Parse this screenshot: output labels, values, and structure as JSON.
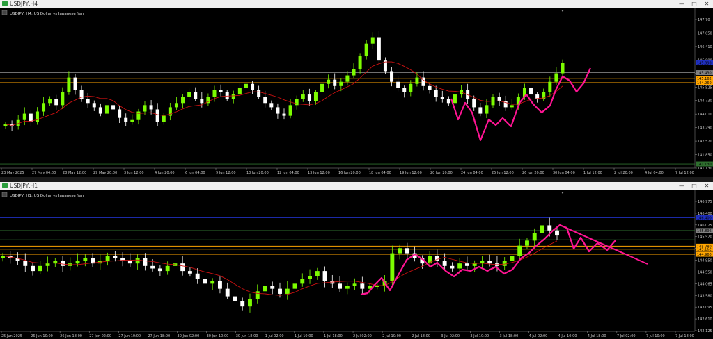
{
  "windows": [
    {
      "title": "USDJPY,H4",
      "header": "USDJPY, H4:  US Dollar vs Japanese Yen",
      "controls": [
        "—",
        "□",
        "✕"
      ]
    },
    {
      "title": "USDJPY,H1",
      "header": "USDJPY, H1:  US Dollar vs Japanese Yen",
      "controls": [
        "—",
        "□",
        "✕"
      ]
    }
  ],
  "colors": {
    "bull": "#7cfc00",
    "bear": "#ffffff",
    "ma": "#cc1111",
    "drawing": "#ff1493",
    "hline_blue": "#1f2fbf",
    "hline_orange": "#ffa500",
    "hline_gray": "#808080",
    "hline_green": "#2e6e2e"
  },
  "chart_data": [
    {
      "type": "candlestick",
      "title": "USDJPY, H4: US Dollar vs Japanese Yen",
      "ylim": [
        141.0,
        148.0
      ],
      "yticks": [
        "147.70",
        "147.050",
        "146.410",
        "145.890",
        "145.730",
        "145.525",
        "144.730",
        "144.010",
        "143.290",
        "142.570",
        "141.850",
        "141.130"
      ],
      "xticks": [
        "23 May 2025",
        "27 May 04:00",
        "28 May 12:00",
        "29 May 20:00",
        "3 Jun 12:00",
        "4 Jun 20:00",
        "6 Jun 04:00",
        "9 Jun 12:00",
        "10 Jun 20:00",
        "12 Jun 04:00",
        "13 Jun 12:00",
        "16 Jun 20:00",
        "18 Jun 04:00",
        "19 Jun 12:00",
        "20 Jun 20:00",
        "24 Jun 04:00",
        "25 Jun 12:00",
        "26 Jun 20:00",
        "30 Jun 04:00",
        "1 Jul 12:00",
        "2 Jul 20:00",
        "4 Jul 04:00",
        "7 Jul 12:00"
      ],
      "price_labels": [
        {
          "text": "145.890",
          "bg": "#1f2fbf"
        },
        {
          "text": "145.430",
          "bg": "#808080"
        },
        {
          "text": "145.162",
          "bg": "#ffa500"
        },
        {
          "text": "144.960",
          "bg": "#ffa500"
        },
        {
          "text": "141.130",
          "bg": "#2e6e2e"
        }
      ],
      "hlines": [
        {
          "y": 145.89,
          "color": "blue"
        },
        {
          "y": 145.43,
          "color": "gray"
        },
        {
          "y": 145.16,
          "color": "orange"
        },
        {
          "y": 144.96,
          "color": "orange"
        },
        {
          "y": 141.13,
          "color": "green"
        }
      ],
      "close": [
        143.0,
        142.9,
        143.2,
        143.5,
        143.1,
        143.6,
        144.0,
        144.2,
        143.9,
        144.5,
        145.2,
        144.6,
        144.2,
        144.0,
        143.8,
        143.5,
        143.9,
        143.7,
        143.3,
        143.1,
        143.2,
        143.6,
        143.9,
        143.7,
        143.1,
        143.4,
        143.8,
        144.0,
        144.3,
        144.5,
        144.2,
        144.0,
        144.3,
        144.6,
        144.5,
        144.2,
        144.4,
        144.7,
        144.9,
        144.6,
        144.3,
        144.0,
        143.8,
        143.5,
        143.4,
        143.9,
        144.2,
        144.4,
        144.1,
        144.5,
        144.9,
        145.1,
        144.8,
        145.0,
        145.3,
        145.6,
        146.2,
        146.8,
        147.1,
        146.0,
        145.5,
        145.0,
        144.7,
        144.5,
        144.9,
        145.2,
        144.8,
        144.6,
        144.3,
        144.2,
        144.0,
        144.4,
        144.6,
        144.2,
        143.8,
        143.5,
        143.9,
        144.3,
        144.1,
        143.8,
        143.9,
        144.3,
        144.7,
        144.4,
        144.2,
        144.5,
        145.0,
        145.4,
        145.9
      ],
      "ma_series": "21-period",
      "projection_drawing": "pink zigzag"
    },
    {
      "type": "candlestick",
      "title": "USDJPY, H1: US Dollar vs Japanese Yen",
      "ylim": [
        142.0,
        147.1
      ],
      "yticks": [
        "146.975",
        "146.400",
        "146.025",
        "145.520",
        "145.160",
        "144.950",
        "144.550",
        "144.065",
        "143.580",
        "143.095",
        "142.610",
        "142.125"
      ],
      "xticks": [
        "25 Jun 2025",
        "26 Jun 10:00",
        "26 Jun 18:00",
        "27 Jun 02:00",
        "27 Jun 10:00",
        "27 Jun 18:00",
        "30 Jun 02:00",
        "30 Jun 10:00",
        "30 Jun 18:00",
        "1 Jul 02:00",
        "1 Jul 10:00",
        "1 Jul 18:00",
        "2 Jul 02:00",
        "2 Jul 10:00",
        "2 Jul 18:00",
        "3 Jul 02:00",
        "3 Jul 10:00",
        "3 Jul 18:00",
        "4 Jul 02:00",
        "4 Jul 10:00",
        "4 Jul 18:00",
        "7 Jul 02:00",
        "7 Jul 10:00",
        "7 Jul 18:00"
      ],
      "price_labels": [
        {
          "text": "146.400",
          "bg": "#1f2fbf"
        },
        {
          "text": "145.896",
          "bg": "#808080"
        },
        {
          "text": "145.280",
          "bg": "#ffa500"
        },
        {
          "text": "145.162",
          "bg": "#ffa500"
        },
        {
          "text": "144.960",
          "bg": "#ffa500"
        }
      ],
      "hlines": [
        {
          "y": 146.4,
          "color": "blue"
        },
        {
          "y": 145.896,
          "color": "green"
        },
        {
          "y": 145.53,
          "color": "green"
        },
        {
          "y": 145.28,
          "color": "orange"
        },
        {
          "y": 145.16,
          "color": "orange"
        },
        {
          "y": 144.96,
          "color": "orange"
        }
      ],
      "close": [
        144.9,
        144.8,
        144.7,
        144.5,
        144.3,
        144.5,
        144.6,
        144.7,
        144.5,
        144.6,
        144.7,
        144.8,
        144.6,
        144.7,
        144.9,
        144.8,
        144.7,
        144.6,
        144.8,
        144.5,
        144.4,
        144.3,
        144.5,
        144.6,
        144.3,
        144.2,
        144.0,
        143.8,
        143.9,
        143.6,
        143.3,
        143.1,
        142.9,
        143.2,
        143.5,
        143.7,
        143.6,
        143.4,
        143.6,
        143.8,
        144.0,
        144.1,
        144.3,
        143.9,
        143.8,
        143.6,
        143.7,
        143.8,
        143.6,
        143.7,
        143.7,
        143.9,
        145.0,
        145.2,
        145.0,
        144.8,
        144.6,
        144.9,
        144.7,
        144.5,
        144.4,
        144.6,
        144.5,
        144.6,
        144.7,
        144.6,
        144.5,
        144.7,
        144.9,
        145.3,
        145.5,
        145.8,
        146.1,
        145.9,
        145.7
      ],
      "ma_series": "21-period",
      "projection_drawing": "pink descending zigzag with trendline"
    }
  ]
}
